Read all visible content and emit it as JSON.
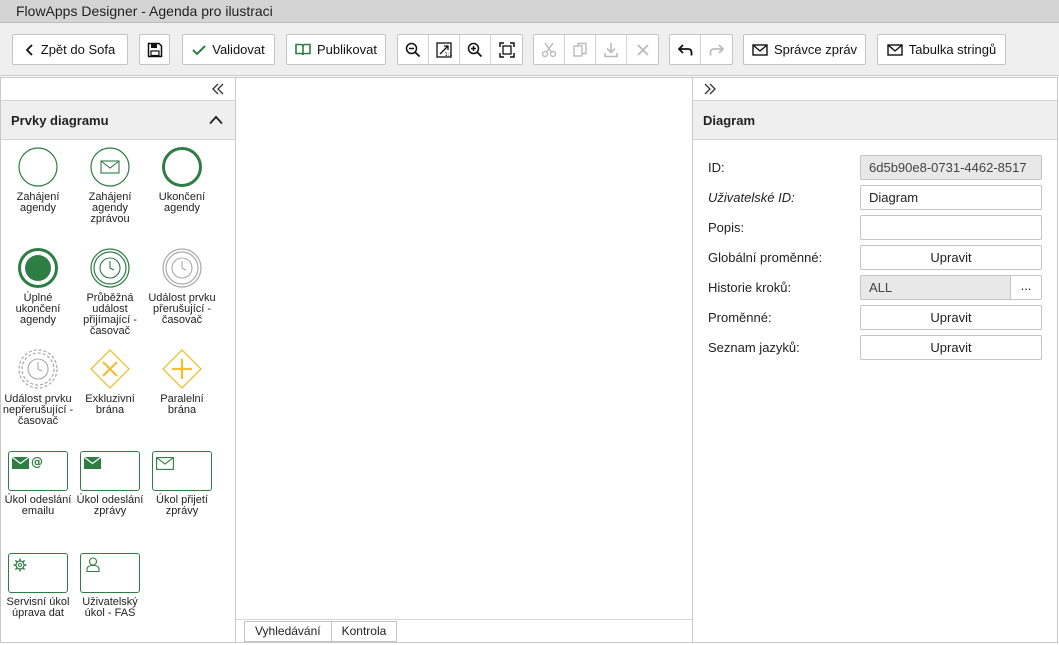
{
  "window": {
    "title": "FlowApps Designer - Agenda pro ilustraci"
  },
  "toolbar": {
    "back_label": "Zpět do Sofa",
    "validate_label": "Validovat",
    "publish_label": "Publikovat",
    "messages_label": "Správce zpráv",
    "strings_label": "Tabulka stringů"
  },
  "left_panel": {
    "title": "Prvky diagramu",
    "items": [
      {
        "label": "Zahájení agendy",
        "icon": "start-event-icon"
      },
      {
        "label": "Zahájení agendy zprávou",
        "icon": "message-start-event-icon"
      },
      {
        "label": "Ukončení agendy",
        "icon": "end-event-icon"
      },
      {
        "label": "Úplné ukončení agendy",
        "icon": "terminate-end-event-icon"
      },
      {
        "label": "Průběžná událost přijímající - časovač",
        "icon": "timer-intermediate-event-icon"
      },
      {
        "label": "Událost prvku přerušující - časovač",
        "icon": "timer-boundary-interrupting-icon"
      },
      {
        "label": "Událost prvku nepřerušující - časovač",
        "icon": "timer-boundary-non-interrupting-icon"
      },
      {
        "label": "Exkluzivní brána",
        "icon": "exclusive-gateway-icon"
      },
      {
        "label": "Paralelní brána",
        "icon": "parallel-gateway-icon"
      },
      {
        "label": "Úkol odeslání emailu",
        "icon": "email-send-task-icon"
      },
      {
        "label": "Úkol odeslání zprávy",
        "icon": "message-send-task-icon"
      },
      {
        "label": "Úkol přijetí zprávy",
        "icon": "message-receive-task-icon"
      },
      {
        "label": "Servisní úkol úprava dat",
        "icon": "service-task-icon"
      },
      {
        "label": "Uživatelský úkol - FAS",
        "icon": "user-task-icon"
      }
    ]
  },
  "bottom_tabs": [
    "Vyhledávání",
    "Kontrola"
  ],
  "right_panel": {
    "title": "Diagram",
    "fields": {
      "id_label": "ID:",
      "id_value": "6d5b90e8-0731-4462-8517",
      "user_id_label": "Uživatelské ID:",
      "user_id_value": "Diagram",
      "desc_label": "Popis:",
      "desc_value": "",
      "global_vars_label": "Globální proměnné:",
      "global_vars_button": "Upravit",
      "history_label": "Historie kroků:",
      "history_value": "ALL",
      "history_button": "...",
      "vars_label": "Proměnné:",
      "vars_button": "Upravit",
      "langs_label": "Seznam jazyků:",
      "langs_button": "Upravit"
    }
  },
  "colors": {
    "accent_green": "#2e7d44",
    "gateway_yellow": "#f0c030"
  }
}
